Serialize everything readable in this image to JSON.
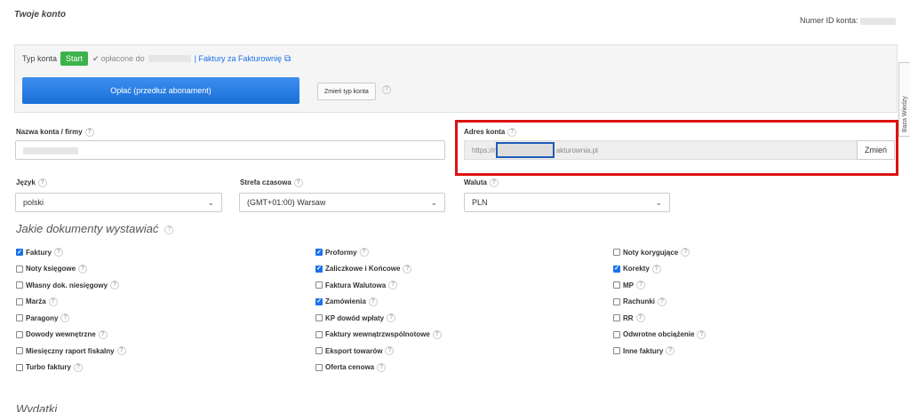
{
  "header": {
    "title": "Twoje konto",
    "account_id_label": "Numer ID konta:"
  },
  "plan": {
    "type_label": "Typ konta",
    "badge": "Start",
    "paid_until": "opłacone do",
    "invoices_link": "| Faktury za Fakturownię",
    "pay_button": "Opłać (przedłuż abonament)",
    "change_type_button": "Zmień typ konta"
  },
  "side_tab": {
    "label": "Baza Wiedzy"
  },
  "company": {
    "label": "Nazwa konta / firmy"
  },
  "address": {
    "label": "Adres konta",
    "prefix": "https://m",
    "suffix": "akturownia.pl",
    "change_button": "Zmień"
  },
  "language": {
    "label": "Język",
    "value": "polski"
  },
  "timezone": {
    "label": "Strefa czasowa",
    "value": "(GMT+01:00) Warsaw"
  },
  "currency": {
    "label": "Waluta",
    "value": "PLN"
  },
  "documents": {
    "title": "Jakie dokumenty wystawiać",
    "col1": [
      {
        "label": "Faktury",
        "checked": true
      },
      {
        "label": "Noty księgowe",
        "checked": false
      },
      {
        "label": "Własny dok. niesięgowy",
        "checked": false
      },
      {
        "label": "Marża",
        "checked": false
      },
      {
        "label": "Paragony",
        "checked": false
      },
      {
        "label": "Dowody wewnętrzne",
        "checked": false
      },
      {
        "label": "Miesięczny raport fiskalny",
        "checked": false
      },
      {
        "label": "Turbo faktury",
        "checked": false
      }
    ],
    "col2": [
      {
        "label": "Proformy",
        "checked": true
      },
      {
        "label": "Zaliczkowe i Końcowe",
        "checked": true
      },
      {
        "label": "Faktura Walutowa",
        "checked": false
      },
      {
        "label": "Zamówienia",
        "checked": true
      },
      {
        "label": "KP dowód wpłaty",
        "checked": false
      },
      {
        "label": "Faktury wewnątrzwspólnotowe",
        "checked": false
      },
      {
        "label": "Eksport towarów",
        "checked": false
      },
      {
        "label": "Oferta cenowa",
        "checked": false
      }
    ],
    "col3": [
      {
        "label": "Noty korygujące",
        "checked": false
      },
      {
        "label": "Korekty",
        "checked": true
      },
      {
        "label": "MP",
        "checked": false
      },
      {
        "label": "Rachunki",
        "checked": false
      },
      {
        "label": "RR",
        "checked": false
      },
      {
        "label": "Odwrotne obciążenie",
        "checked": false
      },
      {
        "label": "Inne faktury",
        "checked": false
      }
    ]
  },
  "expenses": {
    "title": "Wydatki"
  },
  "colors": {
    "primary": "#1a73e8",
    "start_badge": "#3cb34a",
    "highlight": "#d11",
    "focus": "#1e5bb8"
  }
}
